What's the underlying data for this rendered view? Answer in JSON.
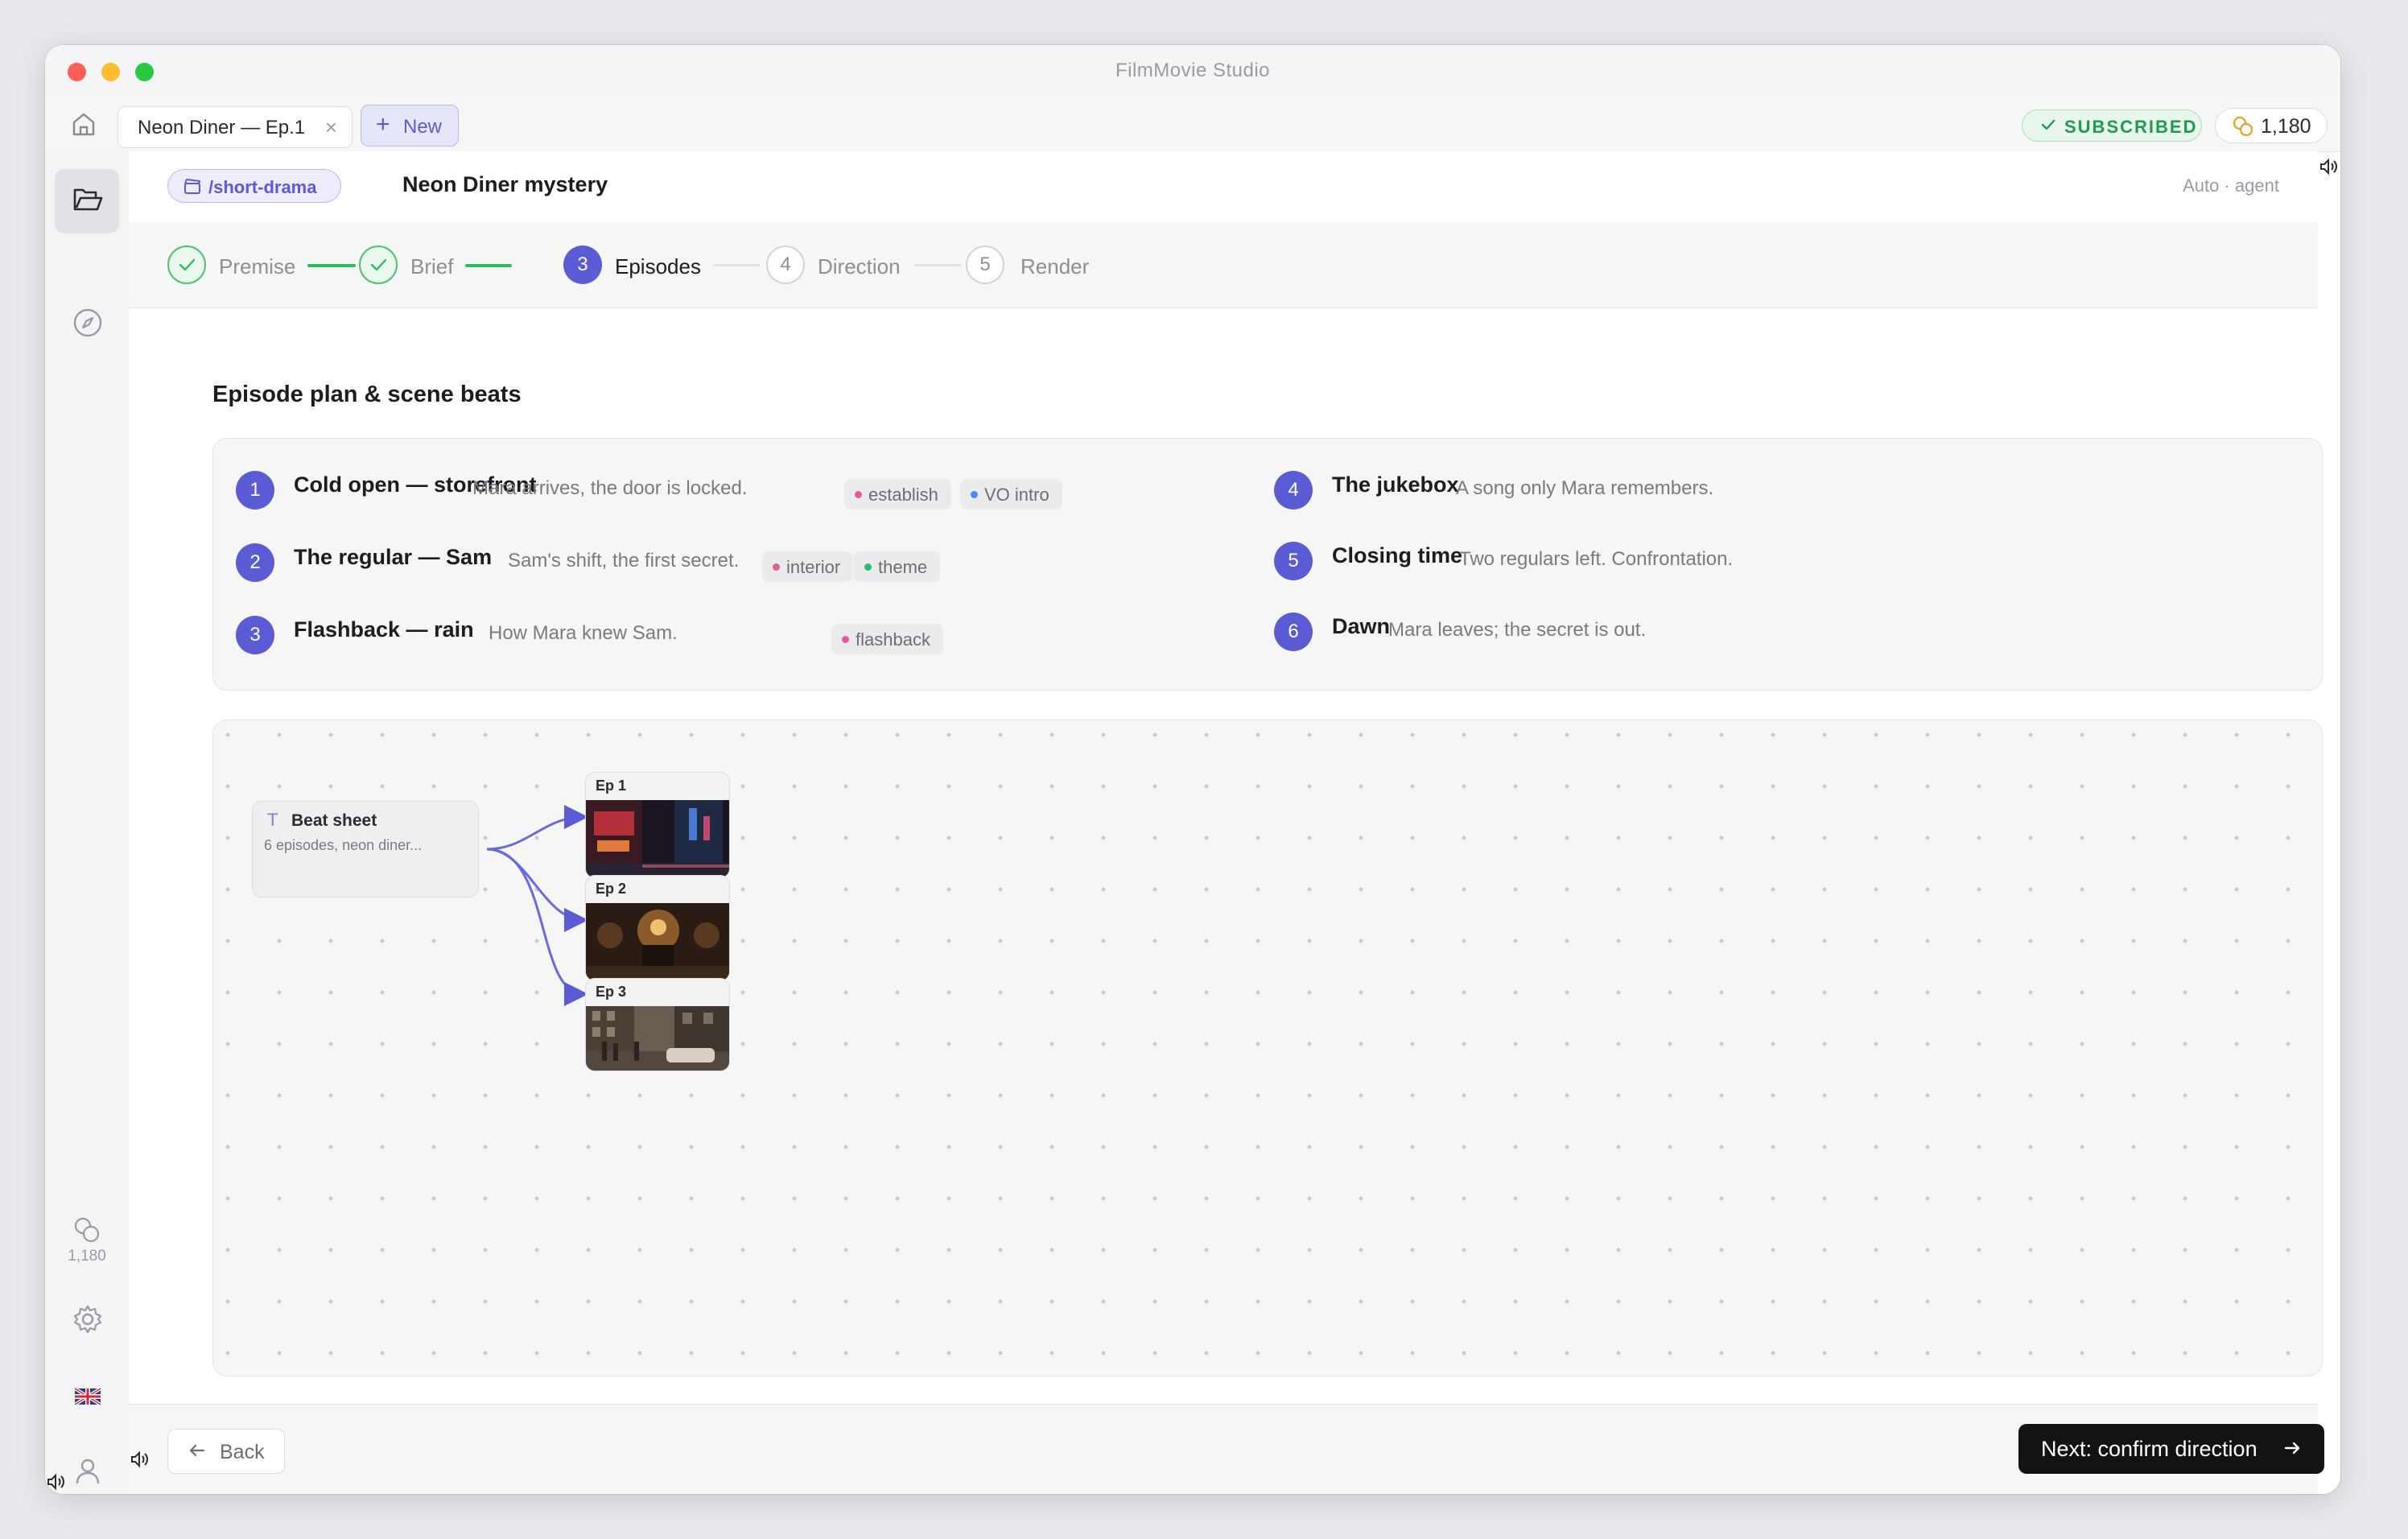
{
  "window": {
    "title": "FilmMovie Studio"
  },
  "tabs": [
    {
      "label": "Neon Diner — Ep.1"
    }
  ],
  "new_tab_label": "New",
  "subscription_badge": "SUBSCRIBED",
  "credits": "1,180",
  "sidebar": {
    "credits_label": "1,180"
  },
  "header": {
    "command": "/short-drama",
    "project_title": "Neon Diner mystery",
    "mode": "Auto · agent"
  },
  "stepper": [
    {
      "label": "Premise",
      "state": "done"
    },
    {
      "label": "Brief",
      "state": "done"
    },
    {
      "label": "Episodes",
      "number": "3",
      "state": "current"
    },
    {
      "label": "Direction",
      "number": "4",
      "state": "upcoming"
    },
    {
      "label": "Render",
      "number": "5",
      "state": "upcoming"
    }
  ],
  "section_title": "Episode plan & scene beats",
  "beats": [
    {
      "number": "1",
      "title": "Cold open — storefront",
      "description": "Mara arrives, the door is locked.",
      "tags": [
        {
          "label": "establish",
          "color": "#e85a9b"
        },
        {
          "label": "VO intro",
          "color": "#4a8de8"
        }
      ]
    },
    {
      "number": "2",
      "title": "The regular — Sam",
      "description": "Sam's shift, the first secret.",
      "tags": [
        {
          "label": "interior",
          "color": "#e85a9b"
        },
        {
          "label": "theme",
          "color": "#2bbd6a"
        }
      ]
    },
    {
      "number": "3",
      "title": "Flashback — rain",
      "description": "How Mara knew Sam.",
      "tags": [
        {
          "label": "flashback",
          "color": "#e85a9b"
        }
      ]
    },
    {
      "number": "4",
      "title": "The jukebox",
      "description": "A song only Mara remembers.",
      "tags": []
    },
    {
      "number": "5",
      "title": "Closing time",
      "description": "Two regulars left. Confrontation.",
      "tags": []
    },
    {
      "number": "6",
      "title": "Dawn",
      "description": "Mara leaves; the secret is out.",
      "tags": []
    }
  ],
  "canvas": {
    "beat_sheet_title": "Beat sheet",
    "beat_sheet_subtitle": "6 episodes, neon diner...",
    "episodes": [
      {
        "label": "Ep 1",
        "thumbnail": "neon rainy street at night"
      },
      {
        "label": "Ep 2",
        "thumbnail": "dim diner interior with lamps"
      },
      {
        "label": "Ep 3",
        "thumbnail": "sepia city street with vintage cars"
      }
    ]
  },
  "footer": {
    "back_label": "Back",
    "next_label": "Next: confirm direction"
  },
  "colors": {
    "accent": "#5b5bd6",
    "success": "#2bbd5b",
    "primary_button": "#131316"
  }
}
